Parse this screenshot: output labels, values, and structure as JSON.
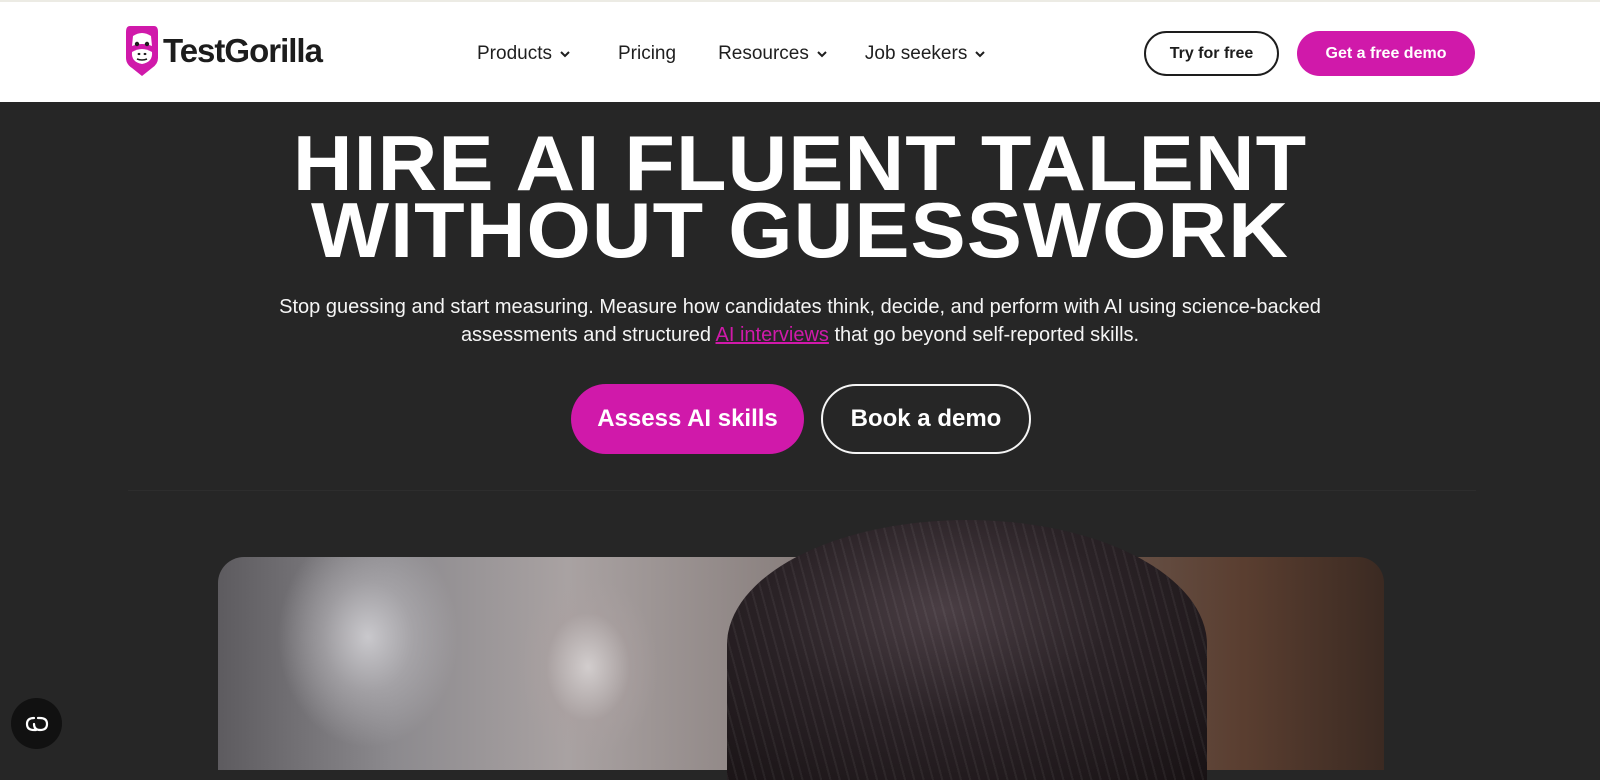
{
  "brand": {
    "name": "TestGorilla",
    "accent": "#d019aa",
    "icon": "gorilla-logo-icon"
  },
  "nav": {
    "items": [
      {
        "label": "Products",
        "dropdown": true
      },
      {
        "label": "Pricing",
        "dropdown": false
      },
      {
        "label": "Resources",
        "dropdown": true
      },
      {
        "label": "Job seekers",
        "dropdown": true
      }
    ],
    "try_free": "Try for free",
    "demo": "Get a free demo"
  },
  "hero": {
    "title_line1": "HIRE AI FLUENT TALENT",
    "title_line2": "WITHOUT GUESSWORK",
    "subtitle_before": "Stop guessing and start measuring. Measure how candidates think, decide, and perform with AI using science-backed assessments and structured",
    "subtitle_link": "AI interviews",
    "subtitle_after": "that go beyond self-reported skills.",
    "cta_primary": "Assess AI skills",
    "cta_secondary": "Book a demo"
  },
  "media": {
    "icon": "accessibility-icon"
  }
}
